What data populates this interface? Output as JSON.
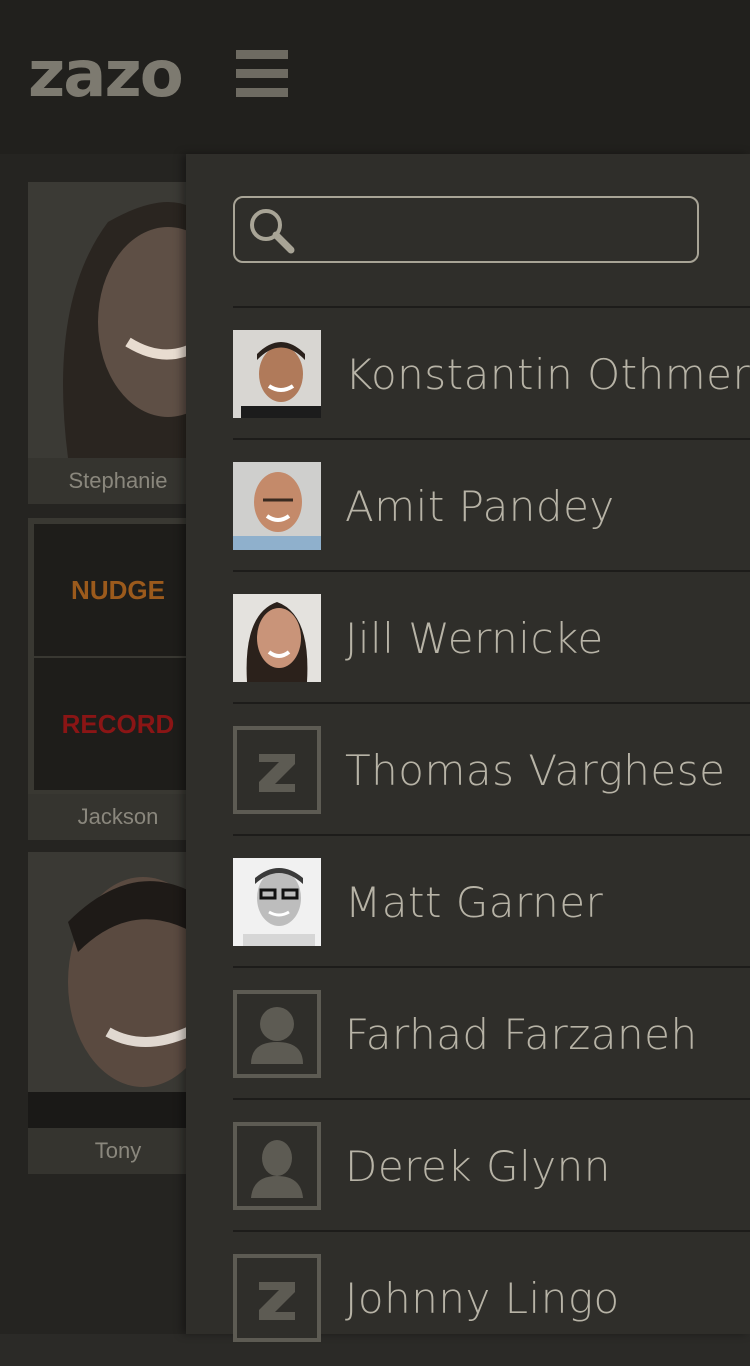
{
  "app": {
    "logo_text": "zazo"
  },
  "background_tiles": [
    {
      "caption": "Stephanie"
    },
    {
      "caption": "Jackson",
      "nudge_label": "NUDGE",
      "record_label": "RECORD"
    },
    {
      "caption": "Tony"
    }
  ],
  "drawer": {
    "search": {
      "placeholder": "",
      "value": ""
    },
    "contacts": [
      {
        "name": "Konstantin Othmer",
        "avatar": "photo"
      },
      {
        "name": "Amit Pandey",
        "avatar": "photo"
      },
      {
        "name": "Jill Wernicke",
        "avatar": "photo"
      },
      {
        "name": "Thomas Varghese",
        "avatar": "zazo-logo-icon"
      },
      {
        "name": "Matt Garner",
        "avatar": "photo"
      },
      {
        "name": "Farhad Farzaneh",
        "avatar": "person-silhouette-icon"
      },
      {
        "name": "Derek Glynn",
        "avatar": "person-silhouette-icon"
      },
      {
        "name": "Johnny Lingo",
        "avatar": "zazo-logo-icon"
      }
    ]
  },
  "colors": {
    "topbar_bg": "#21201d",
    "drawer_bg": "#2f2e2a",
    "text": "#b7b3a6",
    "nudge": "#9b5a1c",
    "record": "#8a1515"
  }
}
